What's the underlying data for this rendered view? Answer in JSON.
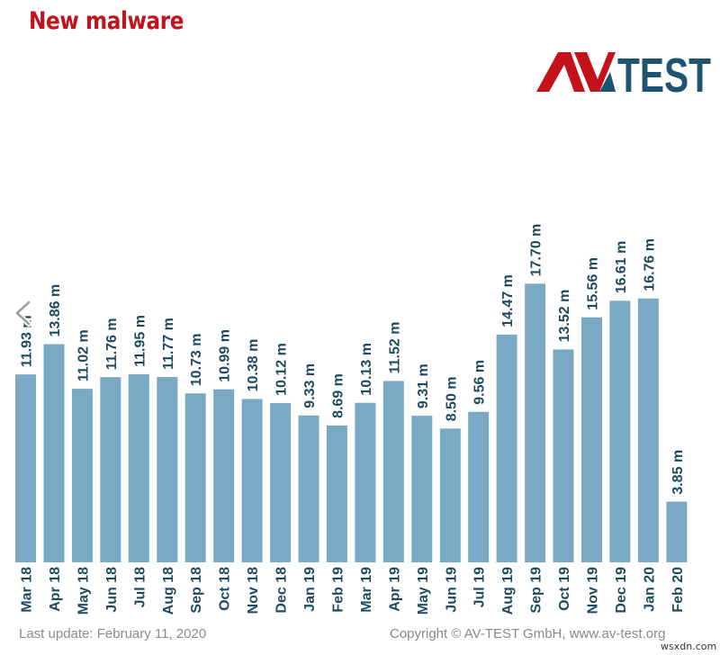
{
  "header": {
    "title": "New malware",
    "logo_text_left": "AV",
    "logo_text_right": "TEST"
  },
  "colors": {
    "title": "#c4121c",
    "logo_red": "#c4121c",
    "logo_blue": "#1d5470",
    "bar": "#7aa9c6",
    "label": "#1d4a5e",
    "footer": "#8a8a8a"
  },
  "chart_data": {
    "type": "bar",
    "title": "New malware",
    "xlabel": "",
    "ylabel": "",
    "unit": "m",
    "ylim": [
      0,
      17.7
    ],
    "grid": false,
    "legend": "none",
    "categories": [
      "Mar 18",
      "Apr 18",
      "May 18",
      "Jun 18",
      "Jul 18",
      "Aug 18",
      "Sep 18",
      "Oct 18",
      "Nov 18",
      "Dec 18",
      "Jan 19",
      "Feb 19",
      "Mar 19",
      "Apr 19",
      "May 19",
      "Jun 19",
      "Jul 19",
      "Aug 19",
      "Sep 19",
      "Oct 19",
      "Nov 19",
      "Dec 19",
      "Jan 20",
      "Feb 20"
    ],
    "values": [
      11.93,
      13.86,
      11.02,
      11.76,
      11.95,
      11.77,
      10.73,
      10.99,
      10.38,
      10.12,
      9.33,
      8.69,
      10.13,
      11.52,
      9.31,
      8.5,
      9.56,
      14.47,
      17.7,
      13.52,
      15.56,
      16.61,
      16.76,
      3.85
    ],
    "data_labels": [
      "11.93 m",
      "13.86 m",
      "11.02 m",
      "11.76 m",
      "11.95 m",
      "11.77 m",
      "10.73 m",
      "10.99 m",
      "10.38 m",
      "10.12 m",
      "9.33 m",
      "8.69 m",
      "10.13 m",
      "11.52 m",
      "9.31 m",
      "8.50 m",
      "9.56 m",
      "14.47 m",
      "17.70 m",
      "13.52 m",
      "15.56 m",
      "16.61 m",
      "16.76 m",
      "3.85 m"
    ]
  },
  "footer": {
    "last_update": "Last update: February 11, 2020",
    "copyright": "Copyright © AV-TEST GmbH, www.av-test.org",
    "watermark": "wsxdn.com"
  },
  "nav": {
    "prev_icon": "chevron-left-icon"
  }
}
